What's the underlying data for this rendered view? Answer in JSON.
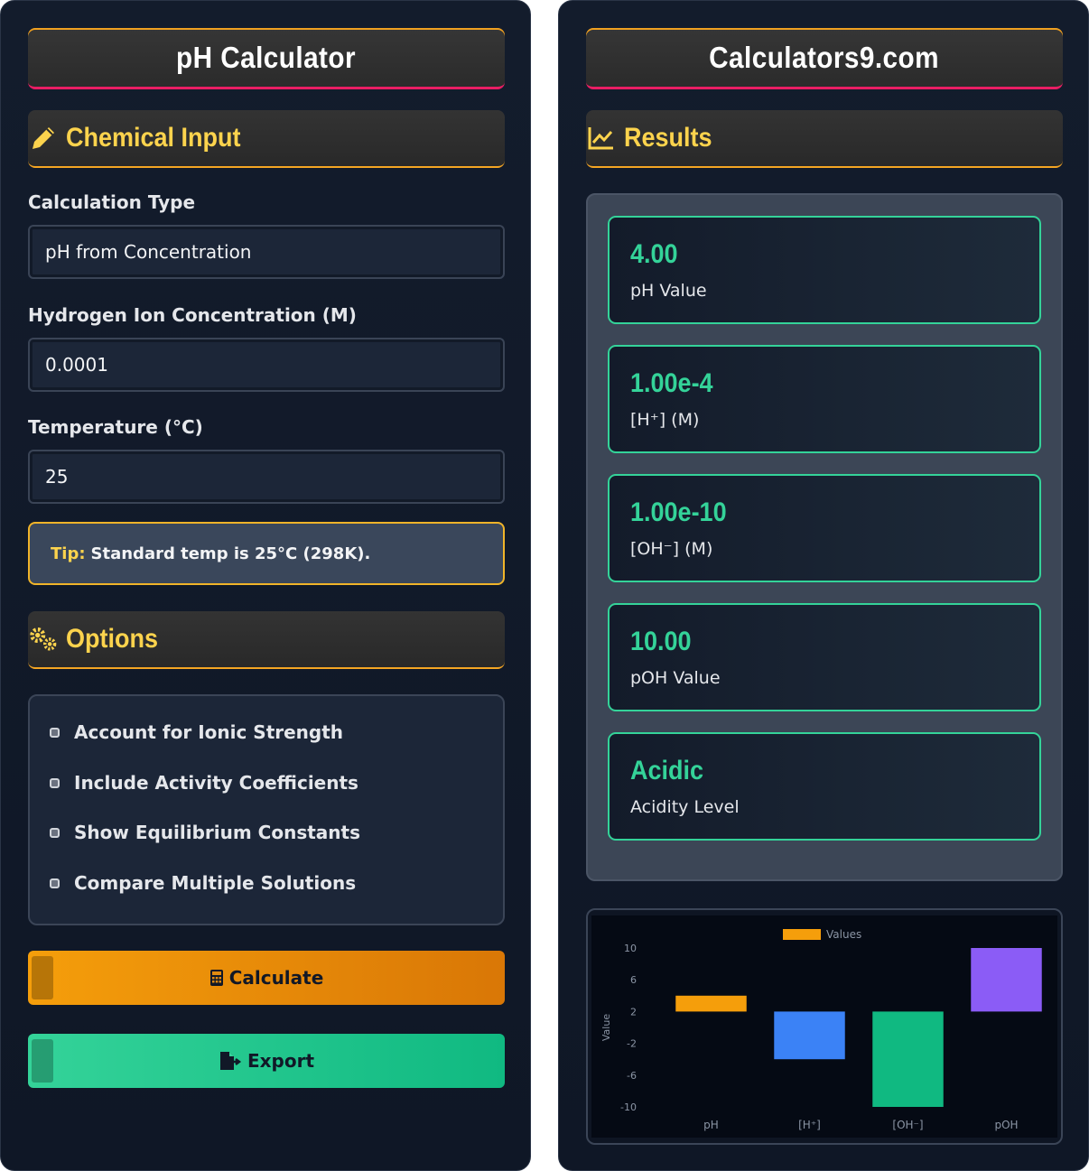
{
  "left": {
    "title": "pH Calculator",
    "input_section": "Chemical Input",
    "calc_type": {
      "label": "Calculation Type",
      "value": "pH from Concentration"
    },
    "concentration": {
      "label": "Hydrogen Ion Concentration (M)",
      "value": "0.0001"
    },
    "temperature": {
      "label": "Temperature (°C)",
      "value": "25"
    },
    "tip": {
      "key": "Tip:",
      "text": "Standard temp is 25°C (298K)."
    },
    "options_section": "Options",
    "options": [
      "Account for Ionic Strength",
      "Include Activity Coefficients",
      "Show Equilibrium Constants",
      "Compare Multiple Solutions"
    ],
    "calculate_label": "Calculate",
    "export_label": "Export"
  },
  "right": {
    "title": "Calculators9.com",
    "results_section": "Results",
    "results": [
      {
        "value": "4.00",
        "label": "pH Value"
      },
      {
        "value": "1.00e-4",
        "label": "[H⁺] (M)"
      },
      {
        "value": "1.00e-10",
        "label": "[OH⁻] (M)"
      },
      {
        "value": "10.00",
        "label": "pOH Value"
      },
      {
        "value": "Acidic",
        "label": "Acidity Level"
      }
    ]
  },
  "colors": {
    "accent_gold": "#fcd34d",
    "accent_green": "#34d399",
    "calculate": "#f59e0b",
    "export": "#10b981"
  },
  "chart_data": {
    "type": "bar",
    "categories": [
      "pH",
      "[H⁺]",
      "[OH⁻]",
      "pOH"
    ],
    "series": [
      {
        "name": "Values",
        "values": [
          4,
          -4,
          -10,
          10
        ],
        "colors": [
          "#f59e0b",
          "#3b82f6",
          "#10b981",
          "#8b5cf6"
        ]
      }
    ],
    "ylabel": "Value",
    "xlabel": "",
    "ylim": [
      -10,
      10
    ],
    "yticks": [
      10,
      6,
      2,
      -2,
      -6,
      -10
    ],
    "legend": "top-center",
    "grid": false
  }
}
